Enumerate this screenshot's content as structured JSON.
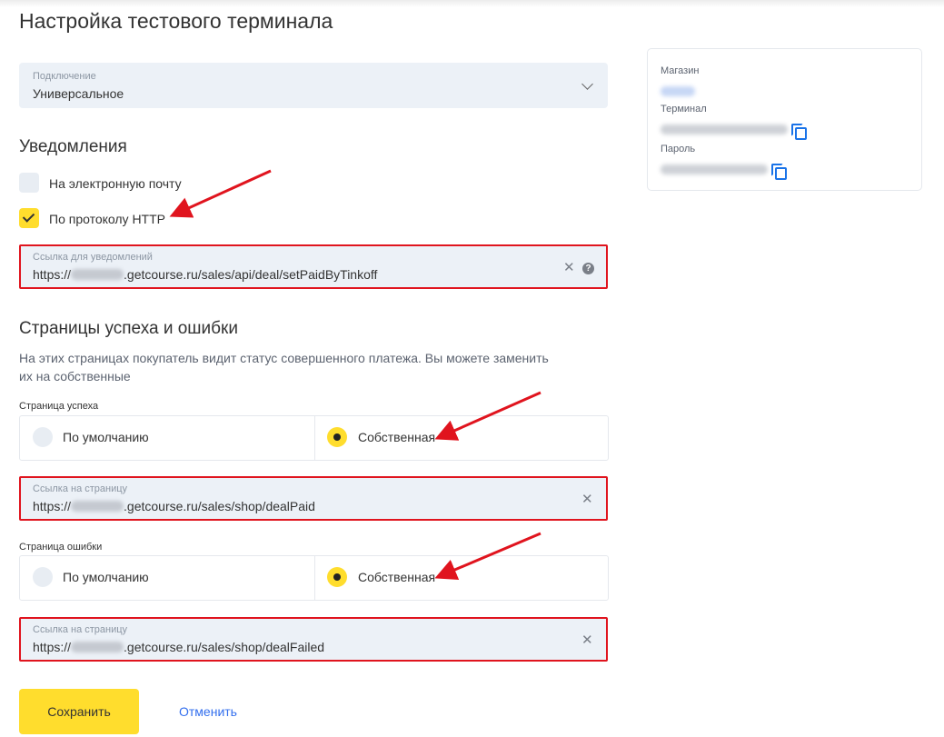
{
  "page": {
    "title": "Настройка тестового терминала"
  },
  "connection": {
    "label": "Подключение",
    "value": "Универсальное"
  },
  "notifications": {
    "heading": "Уведомления",
    "email_label": "На электронную почту",
    "email_checked": false,
    "http_label": "По протоколу HTTP",
    "http_checked": true,
    "url_field": {
      "label": "Ссылка для уведомлений",
      "prefix": "https://",
      "suffix": ".getcourse.ru/sales/api/deal/setPaidByTinkoff"
    }
  },
  "pages": {
    "heading": "Страницы успеха и ошибки",
    "description": "На этих страницах покупатель видит статус совершенного платежа. Вы можете заменить их на собственные",
    "success": {
      "label": "Страница успеха",
      "default_option": "По умолчанию",
      "own_option": "Собственная",
      "selected": "own",
      "url_label": "Ссылка на страницу",
      "url_prefix": "https://",
      "url_suffix": ".getcourse.ru/sales/shop/dealPaid"
    },
    "failure": {
      "label": "Страница ошибки",
      "default_option": "По умолчанию",
      "own_option": "Собственная",
      "selected": "own",
      "url_label": "Ссылка на страницу",
      "url_prefix": "https://",
      "url_suffix": ".getcourse.ru/sales/shop/dealFailed"
    }
  },
  "info_card": {
    "shop_label": "Магазин",
    "terminal_label": "Терминал",
    "password_label": "Пароль"
  },
  "actions": {
    "save": "Сохранить",
    "cancel": "Отменить"
  },
  "colors": {
    "accent": "#ffdd2d",
    "link": "#336fee",
    "highlight": "#e0141e",
    "field_bg": "#ecf1f7"
  }
}
